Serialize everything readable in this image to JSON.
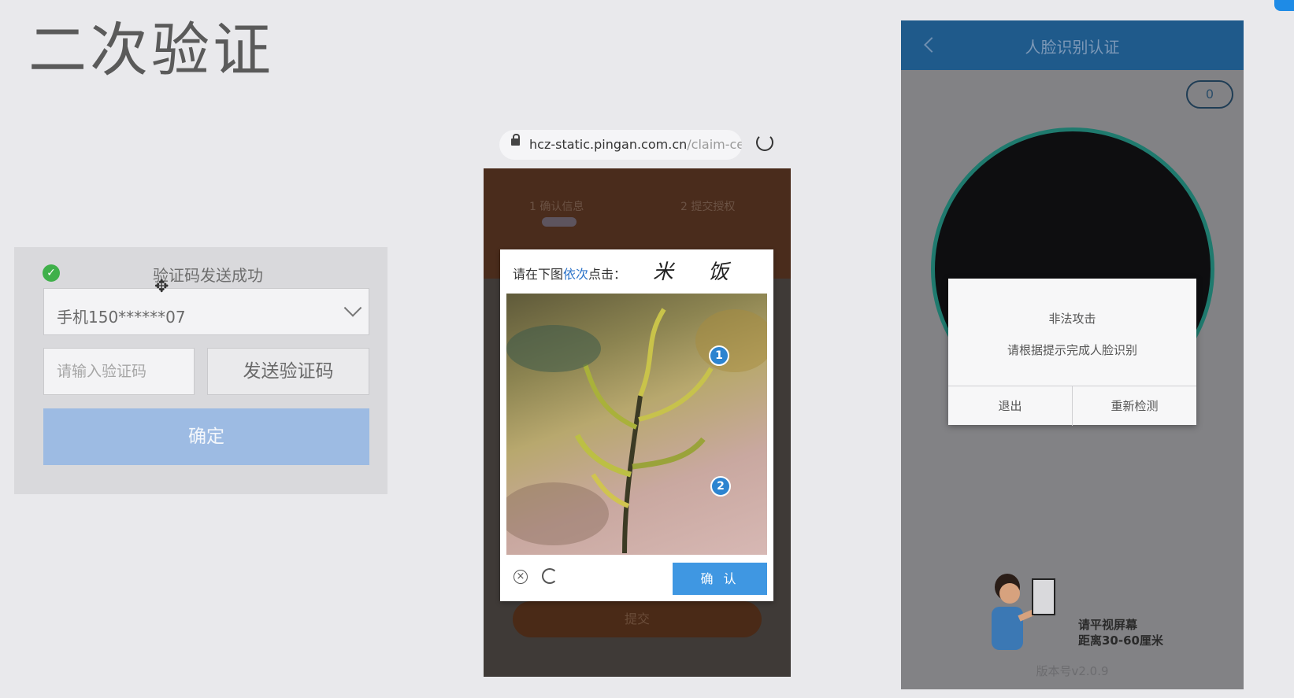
{
  "page_title": "二次验证",
  "sms_panel": {
    "success_text": "验证码发送成功",
    "phone_select_value": "手机150******07",
    "code_placeholder": "请输入验证码",
    "send_code_label": "发送验证码",
    "confirm_label": "确定"
  },
  "browser": {
    "url_host": "hcz-static.pingan.com.cn",
    "url_path": "/claim-ce"
  },
  "mid_phone": {
    "step1_label": "1 确认信息",
    "step2_label": "2 提交授权",
    "submit_label": "提交"
  },
  "captcha": {
    "prompt_prefix": "请在下图",
    "prompt_highlight": "依次",
    "prompt_suffix": "点击：",
    "target_chars": "米 饭",
    "marks": [
      "1",
      "2"
    ],
    "confirm_label": "确 认"
  },
  "face_auth": {
    "header_title": "人脸识别认证",
    "counter_value": "0",
    "dialog_title": "非法攻击",
    "dialog_message": "请根据提示完成人脸识别",
    "exit_label": "退出",
    "retry_label": "重新检测",
    "hint_line1": "请平视屏幕",
    "hint_line2": "距离30-60厘米",
    "version_text": "版本号v2.0.9"
  },
  "colors": {
    "confirm_button": "#9dbbe3",
    "captcha_confirm": "#3f97e2",
    "header_blue": "#1f5a8b",
    "success_green": "#3fb04a"
  }
}
